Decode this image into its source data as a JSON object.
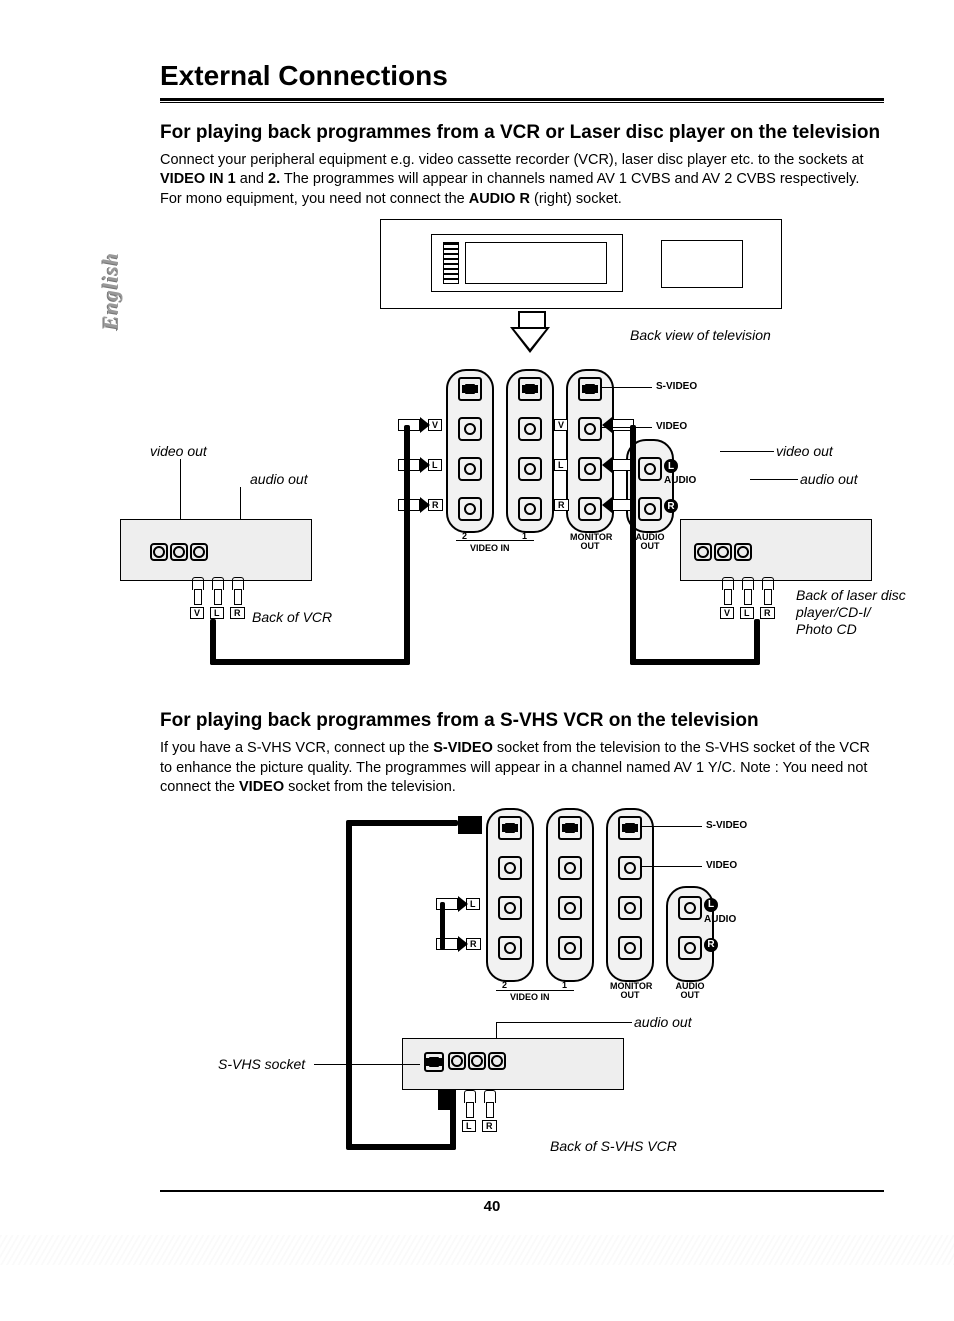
{
  "sideTab": "English",
  "title": "External Connections",
  "section1": {
    "heading": "For playing back programmes from a VCR or Laser disc player on the television",
    "para": "Connect your peripheral equipment e.g. video cassette recorder (VCR), laser disc player etc. to the sockets at ",
    "b1": "VIDEO IN 1",
    "mid1": " and ",
    "b2": "2.",
    "mid2": " The programmes will appear in channels named AV 1 CVBS and AV 2 CVBS respectively. For mono equipment, you need not connect the ",
    "b3": "AUDIO R",
    "tail": " (right) socket."
  },
  "diag1": {
    "tvBack": "Back view of television",
    "videoOutL": "video out",
    "audioOutL": "audio out",
    "videoOutR": "video out",
    "audioOutR": "audio out",
    "backVCR": "Back of VCR",
    "backLD": "Back of laser disc player/CD-I/ Photo CD",
    "svideo": "S-VIDEO",
    "video": "VIDEO",
    "audio": "AUDIO",
    "videoIn": "VIDEO IN",
    "one": "1",
    "two": "2",
    "monOut": "MONITOR OUT",
    "audOut": "AUDIO OUT",
    "L": "L",
    "R": "R",
    "V": "V"
  },
  "section2": {
    "heading": "For playing back programmes from a S-VHS VCR on the television",
    "para1": "If you have a S-VHS VCR, connect up the ",
    "b1": "S-VIDEO",
    "mid1": " socket from the television to the S-VHS socket of the VCR to enhance the picture quality. The programmes will appear in a channel named AV 1 Y/C. Note : You need not connect the ",
    "b2": "VIDEO",
    "tail": " socket from the television."
  },
  "diag2": {
    "svideo": "S-VIDEO",
    "video": "VIDEO",
    "audio": "AUDIO",
    "videoIn": "VIDEO IN",
    "one": "1",
    "two": "2",
    "monOut": "MONITOR OUT",
    "audOut": "AUDIO OUT",
    "svhsSocket": "S-VHS socket",
    "audioOut": "audio out",
    "backSVHS": "Back of S-VHS VCR",
    "L": "L",
    "R": "R"
  },
  "pageNumber": "40"
}
